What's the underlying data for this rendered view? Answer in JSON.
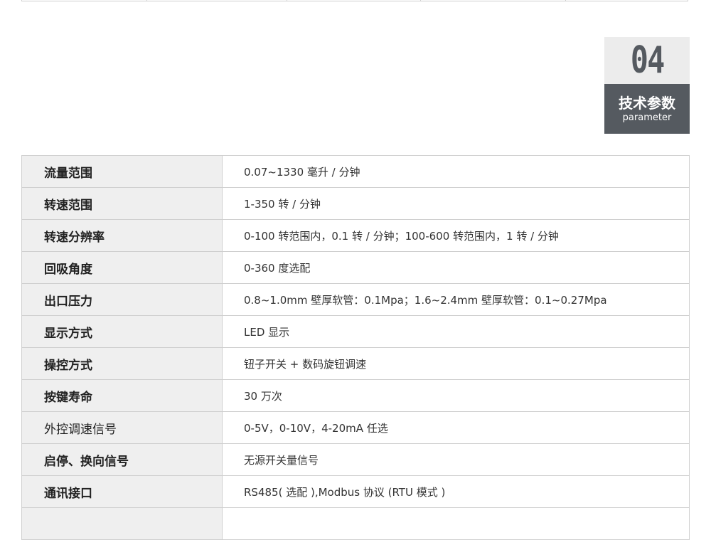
{
  "section": {
    "number": "04",
    "title_zh": "技术参数",
    "title_en": "parameter"
  },
  "params": [
    {
      "key": "流量范围",
      "value": "0.07~1330 毫升 / 分钟"
    },
    {
      "key": "转速范围",
      "value": "1-350 转 / 分钟"
    },
    {
      "key": "转速分辨率",
      "value": "0-100 转范围内，0.1 转 / 分钟；100-600 转范围内，1 转 / 分钟"
    },
    {
      "key": "回吸角度",
      "value": "0-360 度选配"
    },
    {
      "key": "出口压力",
      "value": "0.8~1.0mm 壁厚软管：0.1Mpa；1.6~2.4mm 壁厚软管：0.1~0.27Mpa"
    },
    {
      "key": "显示方式",
      "value": "LED 显示"
    },
    {
      "key": "操控方式",
      "value": "钮子开关 + 数码旋钮调速"
    },
    {
      "key": "按键寿命",
      "value": "30 万次"
    },
    {
      "key": "外控调速信号",
      "value": "0-5V，0-10V，4-20mA 任选"
    },
    {
      "key": "启停、换向信号",
      "value": "无源开关量信号"
    },
    {
      "key": "通讯接口",
      "value": "RS485( 选配 ),Modbus 协议 (RTU 模式 )"
    }
  ]
}
